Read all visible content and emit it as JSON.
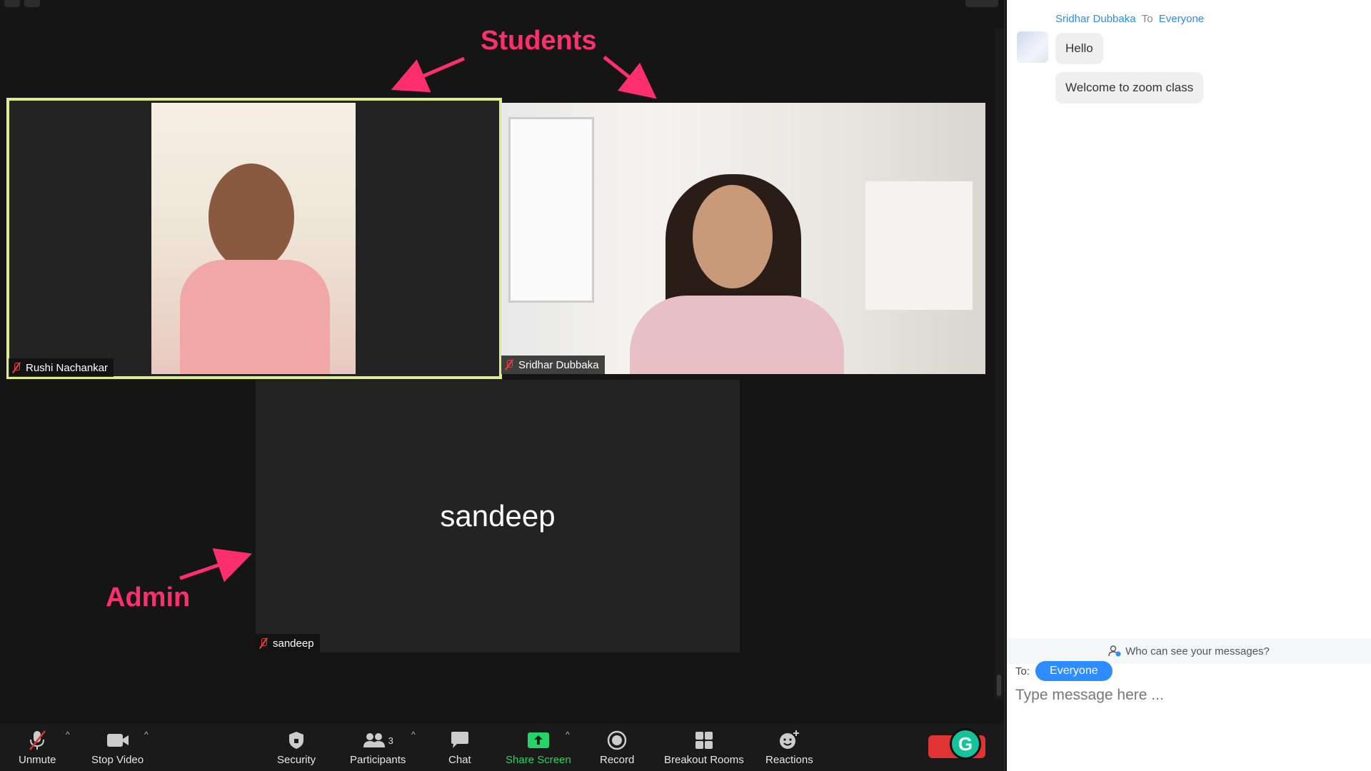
{
  "annotations": {
    "students": "Students",
    "admin": "Admin"
  },
  "tiles": [
    {
      "name": "Rushi Nachankar",
      "active": true
    },
    {
      "name": "Sridhar Dubbaka",
      "active": false
    },
    {
      "name": "sandeep",
      "big_label": "sandeep",
      "active": false
    }
  ],
  "toolbar": {
    "unmute": "Unmute",
    "stop_video": "Stop Video",
    "security": "Security",
    "participants": "Participants",
    "participants_count": "3",
    "chat": "Chat",
    "share_screen": "Share Screen",
    "record": "Record",
    "breakout_rooms": "Breakout Rooms",
    "reactions": "Reactions",
    "caret": "^"
  },
  "chat": {
    "sender": "Sridhar Dubbaka",
    "to_word": "To",
    "recipient": "Everyone",
    "messages": [
      "Hello",
      "Welcome to zoom class"
    ],
    "who_can_see": "Who can see your messages?",
    "to_label": "To:",
    "to_value": "Everyone",
    "input_placeholder": "Type message here ..."
  },
  "grammarly_letter": "G",
  "colors": {
    "accent_blue": "#2d8cff",
    "annotation_pink": "#ff2f6e",
    "active_speaker": "#dcef8a",
    "share_green": "#25d366"
  }
}
